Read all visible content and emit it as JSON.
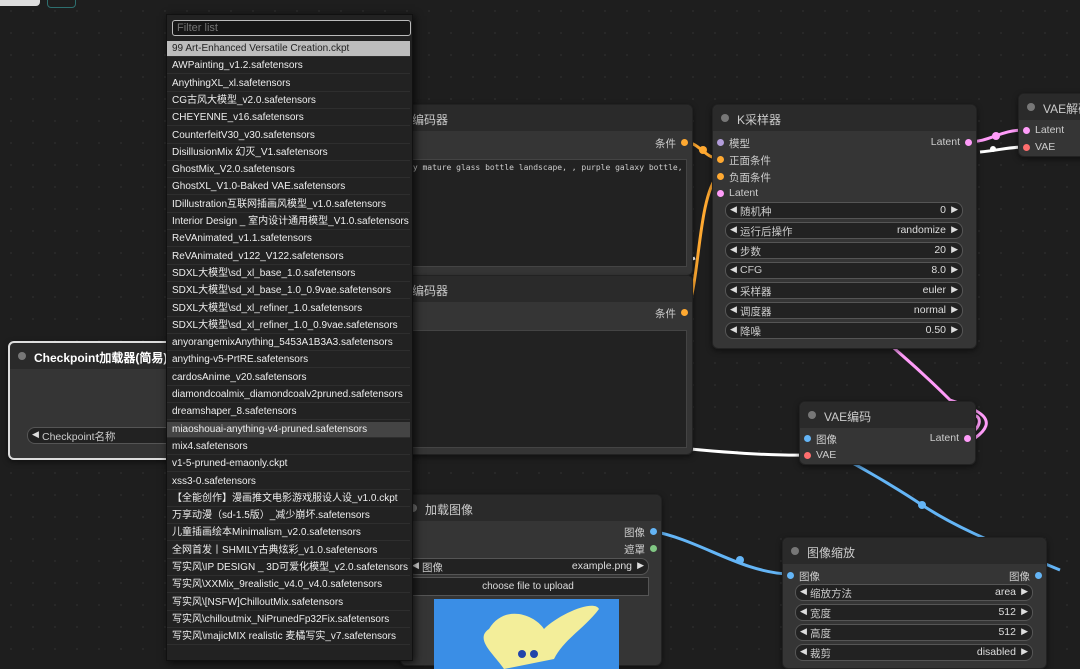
{
  "colors": {
    "model": "#b39ddb",
    "conditioning": "#ffa931",
    "latent": "#ff9cf9",
    "vae": "#ff6e6e",
    "image": "#64b5f6",
    "mask": "#81c784"
  },
  "dropdown": {
    "filter_placeholder": "Filter list",
    "items": [
      "99 Art-Enhanced Versatile Creation.ckpt",
      "AWPainting_v1.2.safetensors",
      "AnythingXL_xl.safetensors",
      "CG古风大模型_v2.0.safetensors",
      "CHEYENNE_v16.safetensors",
      "CounterfeitV30_v30.safetensors",
      "DisillusionMix 幻灭_V1.safetensors",
      "GhostMix_V2.0.safetensors",
      "GhostXL_V1.0-Baked VAE.safetensors",
      "IDillustration互联网插画风模型_v1.0.safetensors",
      "Interior Design _ 室内设计通用模型_V1.0.safetensors",
      "ReVAnimated_v1.1.safetensors",
      "ReVAnimated_v122_V122.safetensors",
      "SDXL大模型\\sd_xl_base_1.0.safetensors",
      "SDXL大模型\\sd_xl_base_1.0_0.9vae.safetensors",
      "SDXL大模型\\sd_xl_refiner_1.0.safetensors",
      "SDXL大模型\\sd_xl_refiner_1.0_0.9vae.safetensors",
      "anyorangemixAnything_5453A1B3A3.safetensors",
      "anything-v5-PrtRE.safetensors",
      "cardosAnime_v20.safetensors",
      "diamondcoalmix_diamondcoalv2pruned.safetensors",
      "dreamshaper_8.safetensors",
      "miaoshouai-anything-v4-pruned.safetensors",
      "mix4.safetensors",
      "v1-5-pruned-emaonly.ckpt",
      "xss3-0.safetensors",
      "【全能创作】漫画推文电影游戏服设人设_v1.0.ckpt",
      "万享动漫（sd-1.5版）_减少崩坏.safetensors",
      "儿童插画绘本Minimalism_v2.0.safetensors",
      "全网首发丨SHMILY古典炫彩_v1.0.safetensors",
      "写实风\\IP DESIGN _ 3D可爱化模型_v2.0.safetensors",
      "写实风\\XXMix_9realistic_v4.0_v4.0.safetensors",
      "写实风\\[NSFW]ChilloutMix.safetensors",
      "写实风\\chilloutmix_NiPrunedFp32Fix.safetensors",
      "写实风\\majicMIX realistic 麦橘写实_v7.safetensors"
    ]
  },
  "checkpoint_node": {
    "title": "Checkpoint加载器(简易)",
    "widget_label": "Checkpoint名称"
  },
  "clip_pos": {
    "title": "编码器",
    "output": "条件",
    "text": "ry mature glass bottle landscape, , purple galaxy bottle,"
  },
  "clip_neg": {
    "title": "编码器",
    "output": "条件"
  },
  "ksampler": {
    "title": "K采样器",
    "inputs": [
      "模型",
      "正面条件",
      "负面条件",
      "Latent"
    ],
    "output": "Latent",
    "widgets": [
      {
        "label": "随机种",
        "value": "0"
      },
      {
        "label": "运行后操作",
        "value": "randomize"
      },
      {
        "label": "步数",
        "value": "20"
      },
      {
        "label": "CFG",
        "value": "8.0"
      },
      {
        "label": "采样器",
        "value": "euler"
      },
      {
        "label": "调度器",
        "value": "normal"
      },
      {
        "label": "降噪",
        "value": "0.50"
      }
    ]
  },
  "vae_decode": {
    "title": "VAE解码",
    "inputs": [
      "Latent",
      "VAE"
    ]
  },
  "vae_encode": {
    "title": "VAE编码",
    "inputs": [
      "图像",
      "VAE"
    ],
    "output": "Latent"
  },
  "load_image": {
    "title": "加载图像",
    "outputs": [
      "图像",
      "遮罩"
    ],
    "widget_label": "图像",
    "widget_value": "example.png",
    "upload_label": "choose file to upload"
  },
  "image_scale": {
    "title": "图像缩放",
    "input": "图像",
    "output": "图像",
    "widgets": [
      {
        "label": "缩放方法",
        "value": "area"
      },
      {
        "label": "宽度",
        "value": "512"
      },
      {
        "label": "高度",
        "value": "512"
      },
      {
        "label": "裁剪",
        "value": "disabled"
      }
    ]
  }
}
